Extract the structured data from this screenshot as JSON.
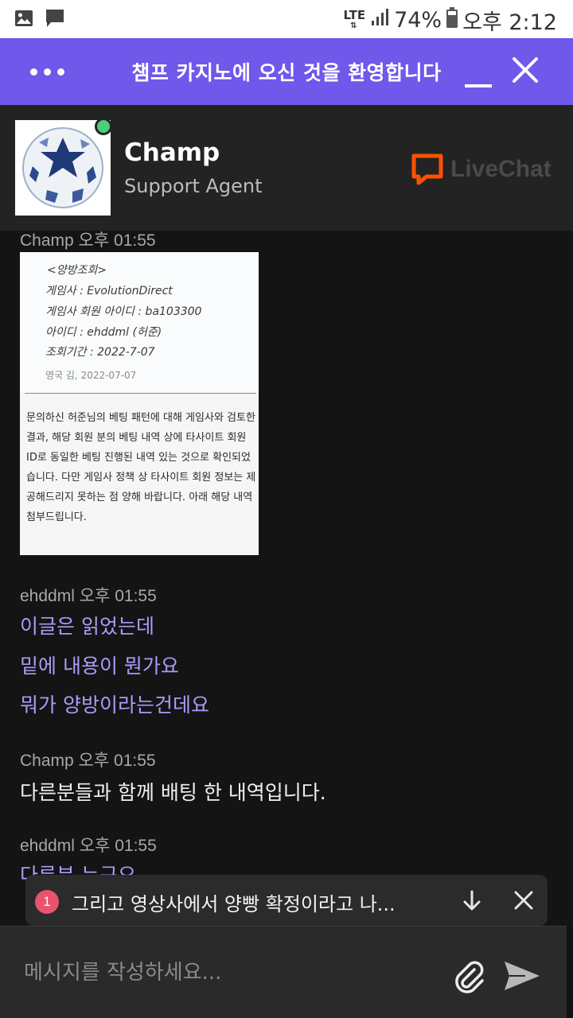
{
  "status_bar": {
    "network": "LTE",
    "battery": "74%",
    "time": "오후 2:12"
  },
  "header": {
    "title": "챔프 카지노에 오신 것을 환영합니다"
  },
  "agent": {
    "name": "Champ",
    "role": "Support Agent",
    "status_color": "#4dce7e",
    "brand": "LiveChat",
    "brand_color": "#ff5100"
  },
  "messages": [
    {
      "author": "Champ",
      "time": "오후 01:55",
      "attachment": {
        "title": "<양방조회>",
        "lines": [
          "게임사 : EvolutionDirect",
          "게임사 회원 아이디 : ba103300",
          "아이디 :   ehddml (허준)",
          "조회기간 : 2022-7-07"
        ],
        "signature": "영국 김, 2022-07-07",
        "body": "문의하신 허준님의 베팅 패턴에 대해 게임사와 검토한 결과, 해당 회원 분의 베팅 내역 상에 타사이트 회원 ID로 동일한 베팅 진행된 내역 있는 것으로 확인되었습니다. 다만 게임사 정책 상 타사이트 회원 정보는 제공해드리지 못하는 점 양해 바랍니다. 아래 해당 내역 첨부드립니다."
      }
    },
    {
      "author": "ehddml",
      "time": "오후 01:55",
      "lines": [
        "이글은 읽었는데",
        "밑에 내용이 뭔가요",
        "뭐가 양방이라는건데요"
      ]
    },
    {
      "author": "Champ",
      "time": "오후 01:55",
      "lines": [
        "다른분들과 함께 배팅 한 내역입니다."
      ]
    },
    {
      "author": "ehddml",
      "time": "오후 01:55",
      "lines": [
        "다른분 누구요"
      ]
    }
  ],
  "toast": {
    "count": "1",
    "text": "그리고 영상사에서 양빵 확정이라고 나...",
    "badge_color": "#e8536e"
  },
  "composer": {
    "placeholder": "메시지를 작성하세요..."
  },
  "colors": {
    "accent": "#6f58ea",
    "visitor_text": "#a99cf8",
    "background": "#141414"
  }
}
